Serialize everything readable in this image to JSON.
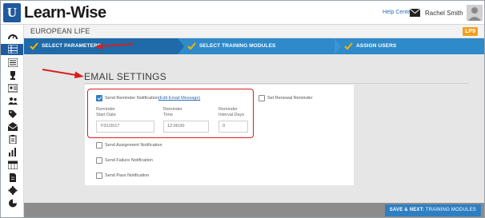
{
  "app": {
    "logo_text": "Learn-Wise",
    "logo_mark": "U"
  },
  "header": {
    "help_center": "Help Center",
    "user_name": "Rachel Smith"
  },
  "course": {
    "title": "EUROPEAN LIFE",
    "badge": "LP9"
  },
  "steps": [
    {
      "label": "SELECT PARAMETERS",
      "active": true
    },
    {
      "label": "SELECT TRAINING MODULES",
      "active": false
    },
    {
      "label": "ASSIGN USERS",
      "active": false
    }
  ],
  "email_settings": {
    "title": "EMAIL SETTINGS",
    "reminder": {
      "label": "Send Reminder Notification",
      "link": "(Edit Email Message)",
      "checked": true
    },
    "renewal": {
      "label": "Set Renewal Reminder",
      "checked": false
    },
    "fields": [
      {
        "label_line1": "Reminder",
        "label_line2": "Start Date",
        "value": "7/31/2017"
      },
      {
        "label_line1": "Reminder",
        "label_line2": "Time",
        "value": "12:00:00"
      },
      {
        "label_line1": "Reminder",
        "label_line2": "Interval Days",
        "value": "0"
      }
    ],
    "options": [
      {
        "label": "Send Assignment Notification",
        "checked": false
      },
      {
        "label": "Send Failure Notification",
        "checked": false
      },
      {
        "label": "Send Pass Notification",
        "checked": false
      }
    ]
  },
  "footer": {
    "save_bold": "SAVE & NEXT:",
    "save_rest": " TRAINING MODULES"
  },
  "sidebar_icons": [
    "dashboard-icon",
    "grid-icon",
    "list-icon",
    "trophy-icon",
    "id-card-icon",
    "users-icon",
    "tag-icon",
    "mail-open-icon",
    "clipboard-icon",
    "bar-chart-icon",
    "calendar-icon",
    "document-icon",
    "gear-icon",
    "pie-chart-icon"
  ],
  "colors": {
    "primary": "#2e8ac9",
    "active_step": "#1f6aa8",
    "annotation": "#d8201b",
    "badge": "#f0a020"
  }
}
